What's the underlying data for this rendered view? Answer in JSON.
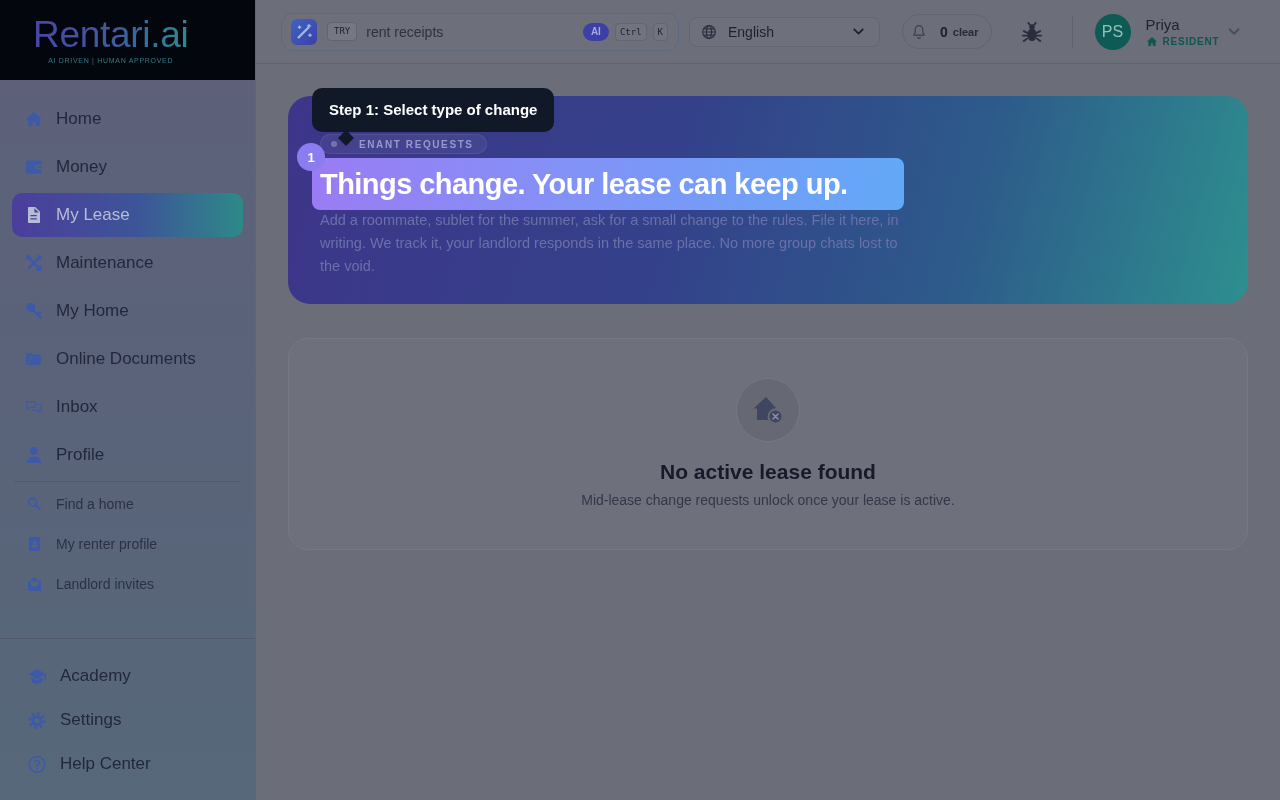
{
  "brand": {
    "name": "Rentari.ai",
    "tagline": "AI DRIVEN | HUMAN APPROVED"
  },
  "sidebar": {
    "items": [
      {
        "label": "Home",
        "selected": false
      },
      {
        "label": "Money",
        "selected": false
      },
      {
        "label": "My Lease",
        "selected": true
      },
      {
        "label": "Maintenance",
        "selected": false
      },
      {
        "label": "My Home",
        "selected": false
      },
      {
        "label": "Online Documents",
        "selected": false
      },
      {
        "label": "Inbox",
        "selected": false
      },
      {
        "label": "Profile",
        "selected": false
      }
    ],
    "secondary_items": [
      {
        "label": "Find a home",
        "selected": false
      },
      {
        "label": "My renter profile",
        "selected": false
      },
      {
        "label": "Landlord invites",
        "selected": false
      }
    ],
    "footer_items": [
      {
        "label": "Academy",
        "selected": false
      },
      {
        "label": "Settings",
        "selected": false
      },
      {
        "label": "Help Center",
        "selected": false
      }
    ]
  },
  "top_bar": {
    "search": {
      "prompt_label": "TRY",
      "placeholder": "rent receipts",
      "ai_badge": "AI",
      "shortcut_keys": [
        "Ctrl",
        "K"
      ]
    },
    "language": {
      "value": "English"
    },
    "notifications": {
      "count": "0",
      "action": "clear"
    },
    "user": {
      "initials": "PS",
      "name": "Priya",
      "role": "RESIDENT"
    }
  },
  "hero": {
    "badge": "ENANT REQUESTS",
    "title": "Things change. Your lease can keep up.",
    "highlighted": true,
    "description": "Add a roommate, sublet for the summer, ask for a small change to the rules. File it here, in writing. We track it, your landlord responds in the same place. No more group chats lost to the void."
  },
  "tour": {
    "step": "1",
    "text": "Step 1: Select type of change"
  },
  "empty_state": {
    "title": "No active lease found",
    "message": "Mid-lease change requests unlock once your lease is active."
  }
}
